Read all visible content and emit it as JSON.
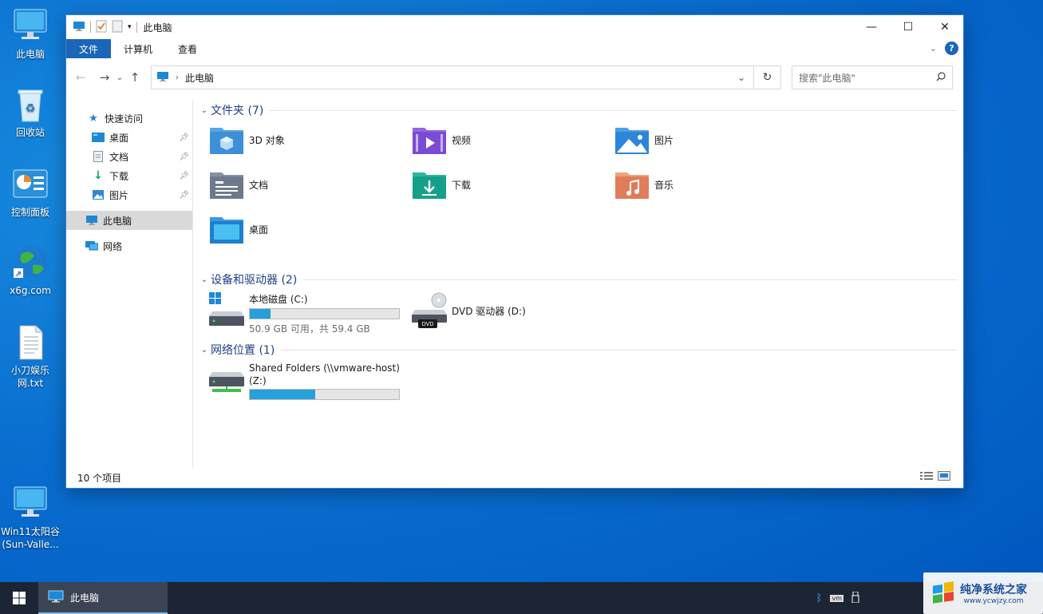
{
  "desktop_icons": [
    {
      "label": "此电脑",
      "icon": "monitor-icon"
    },
    {
      "label": "回收站",
      "icon": "recycle-bin-icon"
    },
    {
      "label": "控制面板",
      "icon": "control-panel-icon"
    },
    {
      "label": "x6g.com",
      "icon": "globe-shortcut-icon"
    },
    {
      "label": "小刀娱乐网.txt",
      "icon": "text-file-icon"
    },
    {
      "label": "Win11太阳谷(Sun-Valle...",
      "icon": "monitor-icon"
    }
  ],
  "window": {
    "title": "此电脑",
    "controls": {
      "minimize": "—",
      "maximize": "☐",
      "close": "✕"
    }
  },
  "ribbon": {
    "tabs": [
      "文件",
      "计算机",
      "查看"
    ],
    "help": "?"
  },
  "address": {
    "back": "←",
    "forward": "→",
    "recent": "⌄",
    "up": "↑",
    "crumb": "此电脑",
    "dropdown": "⌄",
    "refresh": "↻",
    "search_placeholder": "搜索\"此电脑\""
  },
  "nav": {
    "quick_access": "快速访问",
    "items": [
      {
        "label": "桌面",
        "icon": "desktop-icon",
        "pinned": true
      },
      {
        "label": "文档",
        "icon": "documents-icon",
        "pinned": true
      },
      {
        "label": "下载",
        "icon": "download-icon",
        "pinned": true
      },
      {
        "label": "图片",
        "icon": "pictures-icon",
        "pinned": true
      }
    ],
    "this_pc": "此电脑",
    "network": "网络"
  },
  "groups": {
    "folders_header": "文件夹 (7)",
    "folders": [
      {
        "label": "3D 对象",
        "icon": "3d-objects-folder-icon",
        "color": "#3c8fd8"
      },
      {
        "label": "视频",
        "icon": "videos-folder-icon",
        "color": "#7b4bd4"
      },
      {
        "label": "图片",
        "icon": "pictures-folder-icon",
        "color": "#2d86d9"
      },
      {
        "label": "文档",
        "icon": "documents-folder-icon",
        "color": "#6d7a8d"
      },
      {
        "label": "下载",
        "icon": "downloads-folder-icon",
        "color": "#16a08a"
      },
      {
        "label": "音乐",
        "icon": "music-folder-icon",
        "color": "#e07c5a"
      },
      {
        "label": "桌面",
        "icon": "desktop-folder-icon",
        "color": "#1e7fd0"
      }
    ],
    "drives_header": "设备和驱动器 (2)",
    "drives": [
      {
        "label": "本地磁盘 (C:)",
        "usage_fraction": 0.14,
        "free_text": "50.9 GB 可用，共 59.4 GB",
        "icon": "windows-drive-icon"
      },
      {
        "label": "DVD 驱动器 (D:)",
        "icon": "dvd-drive-icon",
        "dvd_badge": "DVD"
      }
    ],
    "network_header": "网络位置 (1)",
    "network": [
      {
        "label": "Shared Folders (\\\\vmware-host)",
        "label2": "(Z:)",
        "usage_fraction": 0.44,
        "icon": "network-drive-icon"
      }
    ]
  },
  "status": {
    "count": "10 个项目"
  },
  "taskbar": {
    "app_label": "此电脑",
    "tray": [
      "bluetooth-icon",
      "vmware-icon",
      "usb-icon"
    ]
  },
  "watermark": {
    "title": "纯净系统之家",
    "url": "www.ycwjzy.com"
  },
  "colors": {
    "accent": "#1a66b8",
    "bar_fill": "#26a0da",
    "group_header": "#1e3f8a",
    "taskbar": "#1c2533"
  }
}
